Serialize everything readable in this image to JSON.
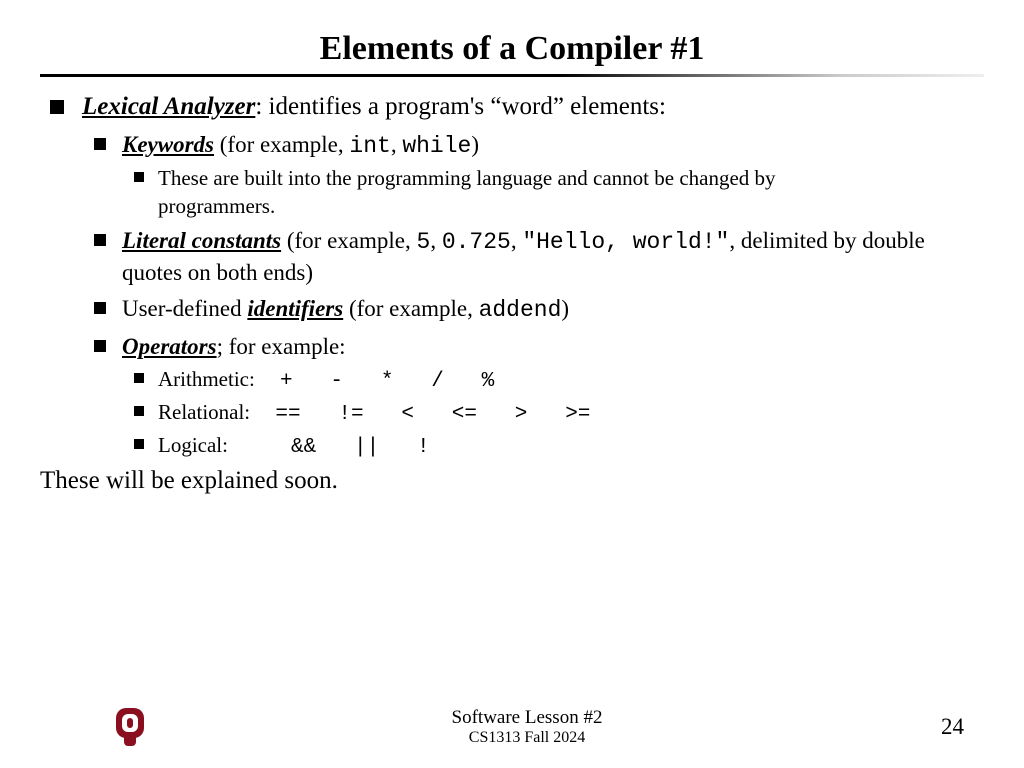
{
  "title": "Elements of a Compiler #1",
  "b1": {
    "term": "Lexical Analyzer",
    "rest": ": identifies a program's “word” elements:"
  },
  "kw": {
    "term": "Keywords",
    "pre": " (for example, ",
    "c1": "int",
    "sep": ", ",
    "c2": "while",
    "post": ")",
    "desc": "These are built into the programming language and cannot be changed by programmers."
  },
  "lit": {
    "term": "Literal constants",
    "pre": " (for example, ",
    "c1": "5",
    "s1": ", ",
    "c2": "0.725",
    "s2": ", ",
    "c3": "\"Hello, world!\"",
    "post": ", delimited by double quotes on both ends)"
  },
  "id": {
    "pre": "User-defined ",
    "term": "identifiers",
    "mid": " (for example, ",
    "c1": "addend",
    "post": ")"
  },
  "op": {
    "term": "Operators",
    "post": "; for example:",
    "arith_label": "Arithmetic:",
    "arith_ops": "  +   -   *   /   %",
    "rel_label": "Relational:",
    "rel_ops": "  ==   !=   <   <=   >   >=",
    "log_label": "Logical:",
    "log_ops": "     &&   ||   !"
  },
  "closing": "These will be explained soon.",
  "footer": {
    "line1": "Software Lesson #2",
    "line2": "CS1313 Fall 2024",
    "page": "24"
  }
}
